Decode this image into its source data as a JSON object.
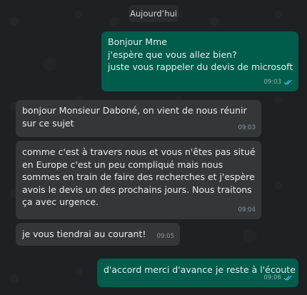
{
  "date_chip": "Aujourd’hui",
  "messages": [
    {
      "direction": "out",
      "lines": [
        "Bonjour Mme",
        "j'espère que vous allez bien?",
        "juste vous rappeler du devis de microsoft"
      ],
      "time": "09:03",
      "status": "read"
    },
    {
      "direction": "in",
      "lines": [
        "bonjour Monsieur Daboné, on vient de nous réunir",
        "sur ce sujet"
      ],
      "time": "09:03"
    },
    {
      "direction": "in",
      "lines": [
        "comme c'est à travers nous et vous n'êtes pas situé",
        "en Europe c'est un peu compliqué mais nous",
        "sommes en train de faire des recherches et j'espère",
        "avois le devis un des prochains jours. Nous traitons",
        "ça avec urgence."
      ],
      "time": "09:04"
    },
    {
      "direction": "in",
      "lines": [
        "je vous tiendrai au courant!"
      ],
      "time": "09:05"
    },
    {
      "direction": "out",
      "lines": [
        "d'accord merci d'avance je reste à l'écoute"
      ],
      "time": "09:06",
      "status": "read"
    }
  ],
  "colors": {
    "outgoing_bubble": "#005c4b",
    "incoming_bubble": "#343739",
    "read_ticks": "#53bdeb"
  }
}
